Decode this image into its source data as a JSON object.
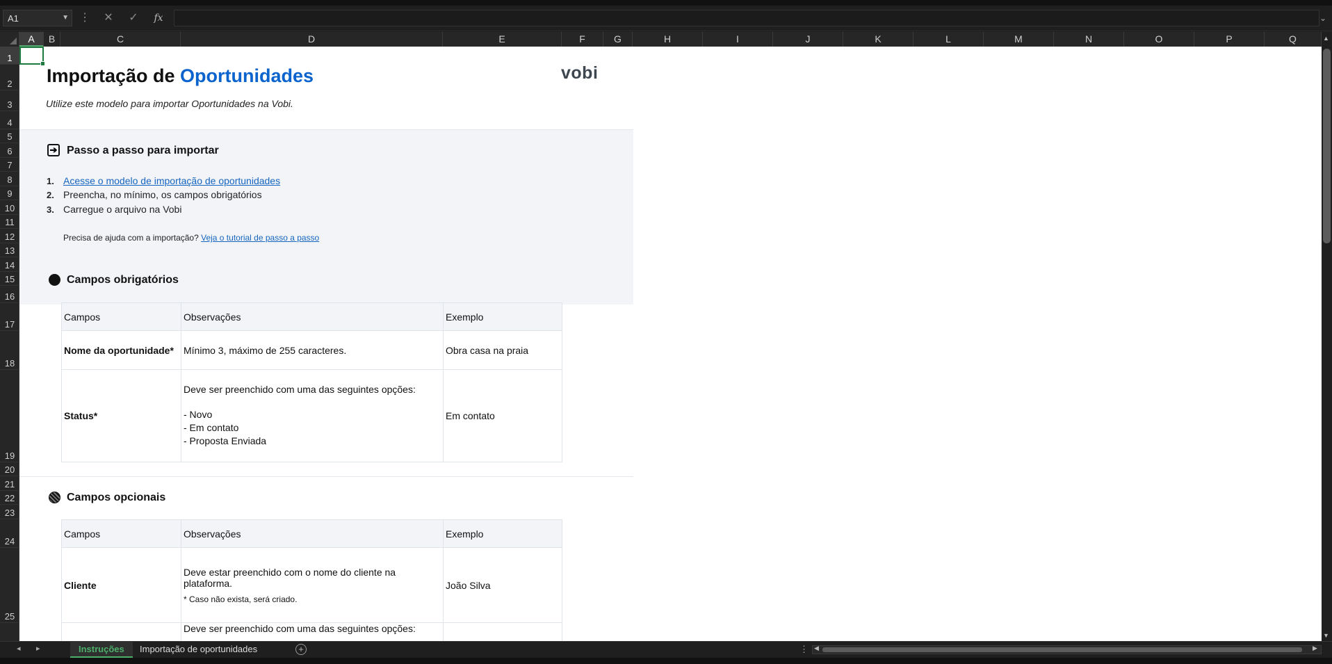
{
  "formula_bar": {
    "name_box": "A1",
    "cancel_icon": "✕",
    "enter_icon": "✓",
    "fx_label": "fx",
    "formula": ""
  },
  "columns": [
    "A",
    "B",
    "C",
    "D",
    "E",
    "F",
    "G",
    "H",
    "I",
    "J",
    "K",
    "L",
    "M",
    "N",
    "O",
    "P",
    "Q"
  ],
  "rows": [
    "1",
    "2",
    "3",
    "4",
    "5",
    "6",
    "7",
    "8",
    "9",
    "10",
    "11",
    "12",
    "13",
    "14",
    "15",
    "16",
    "17",
    "18",
    "19",
    "20",
    "21",
    "22",
    "23",
    "24",
    "25"
  ],
  "doc": {
    "title_part1": "Importação de ",
    "title_part2": "Oportunidades",
    "subtitle": "Utilize este modelo para importar Oportunidades na Vobi.",
    "logo": "vobi",
    "steps_title": "Passo a passo para importar",
    "steps": [
      {
        "n": "1.",
        "text": "Acesse o modelo de importação de oportunidades"
      },
      {
        "n": "2.",
        "text": "Preencha, no mínimo, os campos obrigatórios"
      },
      {
        "n": "3.",
        "text": "Carregue o arquivo na Vobi"
      }
    ],
    "help_text": "Precisa de ajuda com a importação? ",
    "help_link": "Veja o tutorial de passo a passo",
    "required_title": "Campos obrigatórios",
    "optional_title": "Campos opcionais",
    "table_headers": [
      "Campos",
      "Observações",
      "Exemplo"
    ],
    "required_rows": [
      {
        "field": "Nome da oportunidade*",
        "obs": "Mínimo 3, máximo de 255 caracteres.",
        "example": "Obra casa na praia"
      },
      {
        "field": "Status*",
        "obs_intro": "Deve ser preenchido com uma das seguintes opções:",
        "obs_options": [
          "- Novo",
          "- Em contato",
          "- Proposta Enviada"
        ],
        "example": "Em contato"
      }
    ],
    "optional_rows": [
      {
        "field": "Cliente",
        "obs": "Deve estar preenchido com o nome do cliente na plataforma.",
        "note": "* Caso não exista, será criado.",
        "example": "João Silva"
      },
      {
        "field": "",
        "obs": "Deve ser preenchido com uma das seguintes opções:",
        "example": ""
      }
    ]
  },
  "tabs": [
    "Instruções",
    "Importação de oportunidades"
  ],
  "colors": {
    "accent_green": "#1f7a3f",
    "title_blue": "#0b63ce",
    "link_blue": "#1565c0",
    "band": "#f2f4f8"
  }
}
